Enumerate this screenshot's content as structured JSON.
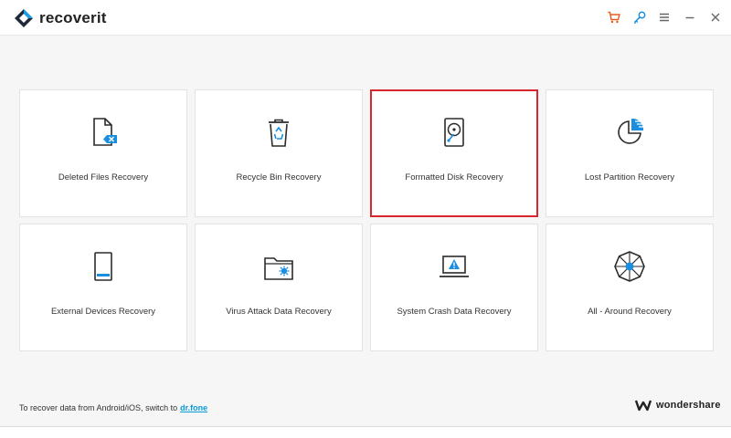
{
  "app": {
    "name": "recoverit"
  },
  "titlebar": {
    "buttons": [
      {
        "name": "cart-icon",
        "color": "#e85a1c"
      },
      {
        "name": "key-icon",
        "color": "#1c8ee0"
      },
      {
        "name": "menu-icon",
        "color": "#666666"
      },
      {
        "name": "minimize-icon",
        "color": "#666666"
      },
      {
        "name": "close-icon",
        "color": "#666666"
      }
    ]
  },
  "cards": [
    {
      "id": "deleted-files",
      "label": "Deleted Files Recovery",
      "icon": "deleted-file-icon",
      "selected": false
    },
    {
      "id": "recycle-bin",
      "label": "Recycle Bin Recovery",
      "icon": "recycle-bin-icon",
      "selected": false
    },
    {
      "id": "formatted-disk",
      "label": "Formatted Disk Recovery",
      "icon": "hard-disk-icon",
      "selected": true
    },
    {
      "id": "lost-partition",
      "label": "Lost Partition Recovery",
      "icon": "partition-pie-icon",
      "selected": false
    },
    {
      "id": "external-devices",
      "label": "External Devices Recovery",
      "icon": "external-drive-icon",
      "selected": false
    },
    {
      "id": "virus-attack",
      "label": "Virus Attack Data Recovery",
      "icon": "virus-folder-icon",
      "selected": false
    },
    {
      "id": "system-crash",
      "label": "System Crash Data Recovery",
      "icon": "crashed-laptop-icon",
      "selected": false
    },
    {
      "id": "all-around",
      "label": "All - Around Recovery",
      "icon": "all-around-wheel-icon",
      "selected": false
    }
  ],
  "footer": {
    "text": "To recover data from Android/iOS, switch to",
    "link": "dr.fone",
    "brand": "wondershare"
  },
  "colors": {
    "accent": "#1c8ee0",
    "selected_border": "#d9262e",
    "icon_stroke": "#2b2b2b",
    "link": "#0a9bd6"
  }
}
